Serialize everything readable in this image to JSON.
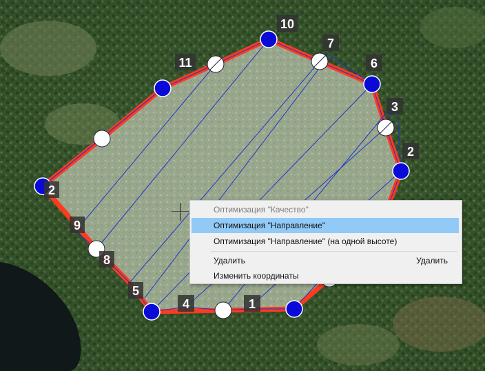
{
  "map": {
    "polygon_color": "#ff3b1f",
    "track_color": "#2233cc",
    "vertex_fill_blue": "#0a0ad8",
    "vertex_fill_white": "#ffffff",
    "labels": [
      "10",
      "7",
      "6",
      "11",
      "3",
      "2",
      "2",
      "9",
      "8",
      "5",
      "4",
      "1"
    ]
  },
  "context_menu": {
    "items": [
      {
        "label": "Оптимизация \"Качество\"",
        "state": "disabled"
      },
      {
        "label": "Оптимизация \"Направление\"",
        "state": "highlighted"
      },
      {
        "label": "Оптимизация \"Направление\" (на одной высоте)",
        "state": "normal"
      },
      {
        "label": "Удалить",
        "shortcut": "Удалить",
        "state": "normal"
      },
      {
        "label": "Изменить координаты",
        "state": "normal"
      }
    ]
  }
}
